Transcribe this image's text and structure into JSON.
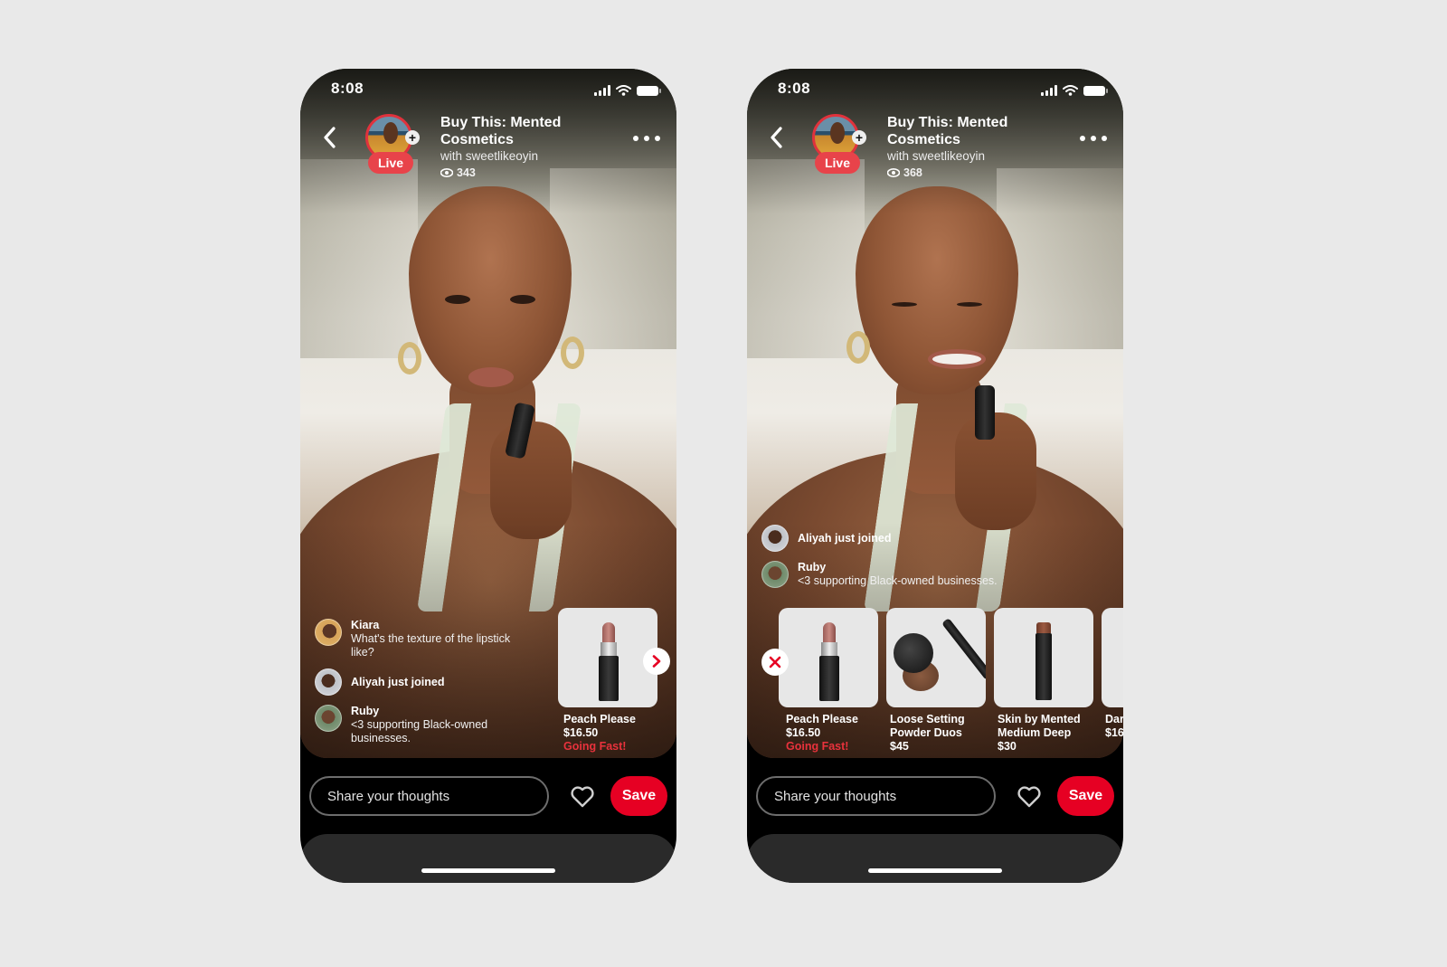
{
  "colors": {
    "page_background": "#e9e9e9",
    "live_badge": "#e8434a",
    "save_button": "#e60023",
    "going_fast": "#e8323c"
  },
  "phones": [
    {
      "status_bar": {
        "time": "8:08",
        "icons": [
          "cellular-signal-icon",
          "wifi-icon",
          "battery-icon"
        ]
      },
      "header": {
        "back_icon": "chevron-left-icon",
        "live_label": "Live",
        "follow_icon": "plus-icon",
        "title": "Buy This: Mented Cosmetics",
        "host": "with sweetlikeoyin",
        "viewer_icon": "eye-icon",
        "viewers": "343",
        "more_icon": "ellipsis-icon"
      },
      "chat": [
        {
          "type": "comment",
          "name": "Kiara",
          "message": "What's the texture of the lipstick like?"
        },
        {
          "type": "joined",
          "message": "Aliyah just joined"
        },
        {
          "type": "comment",
          "name": "Ruby",
          "message": "<3 supporting Black-owned businesses."
        }
      ],
      "products": [
        {
          "name": "Peach Please",
          "price": "$16.50",
          "tag": "Going Fast!",
          "image": "lipstick"
        }
      ],
      "next_icon": "chevron-right-icon",
      "comment_placeholder": "Share your thoughts",
      "like_icon": "heart-outline-icon",
      "save_label": "Save"
    },
    {
      "status_bar": {
        "time": "8:08",
        "icons": [
          "cellular-signal-icon",
          "wifi-icon",
          "battery-icon"
        ]
      },
      "header": {
        "back_icon": "chevron-left-icon",
        "live_label": "Live",
        "follow_icon": "plus-icon",
        "title": "Buy This: Mented Cosmetics",
        "host": "with sweetlikeoyin",
        "viewer_icon": "eye-icon",
        "viewers": "368",
        "more_icon": "ellipsis-icon"
      },
      "chat": [
        {
          "type": "joined",
          "message": "Aliyah just joined"
        },
        {
          "type": "comment",
          "name": "Ruby",
          "message": "<3 supporting Black-owned businesses."
        }
      ],
      "close_icon": "close-x-icon",
      "products": [
        {
          "name": "Peach Please",
          "price": "$16.50",
          "tag": "Going Fast!",
          "image": "lipstick"
        },
        {
          "name": "Loose Setting Powder Duos",
          "price": "$45",
          "tag": "",
          "image": "powder-and-brush"
        },
        {
          "name": "Skin by Mented Medium Deep",
          "price": "$30",
          "tag": "",
          "image": "foundation-stick"
        },
        {
          "name": "Dar",
          "price": "$16",
          "tag": "",
          "image": "partially-visible"
        }
      ],
      "comment_placeholder": "Share your thoughts",
      "like_icon": "heart-outline-icon",
      "save_label": "Save"
    }
  ]
}
